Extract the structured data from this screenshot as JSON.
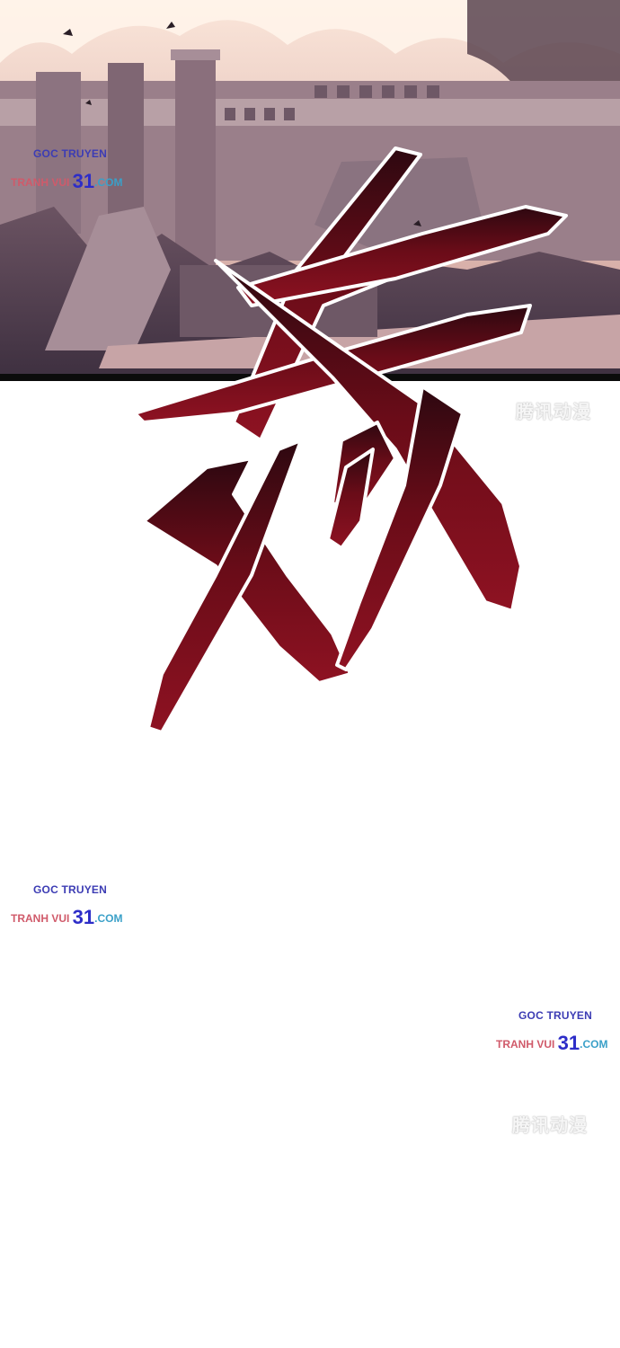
{
  "watermarks": [
    {
      "line1": "GOC TRUYEN",
      "brand": "TRANH VUI ",
      "num": "31",
      "domain": ".COM"
    },
    {
      "line1": "GOC TRUYEN",
      "brand": "TRANH VUI ",
      "num": "31",
      "domain": ".COM"
    },
    {
      "line1": "GOC TRUYEN",
      "brand": "TRANH VUI ",
      "num": "31",
      "domain": ".COM"
    }
  ],
  "stamps": [
    "腾讯动漫",
    "腾讯动漫"
  ],
  "colors": {
    "sfx_top": "#3b0a14",
    "sfx_bottom": "#8a1020",
    "sky": "#f0cfc0",
    "wall": "#7a6270"
  }
}
